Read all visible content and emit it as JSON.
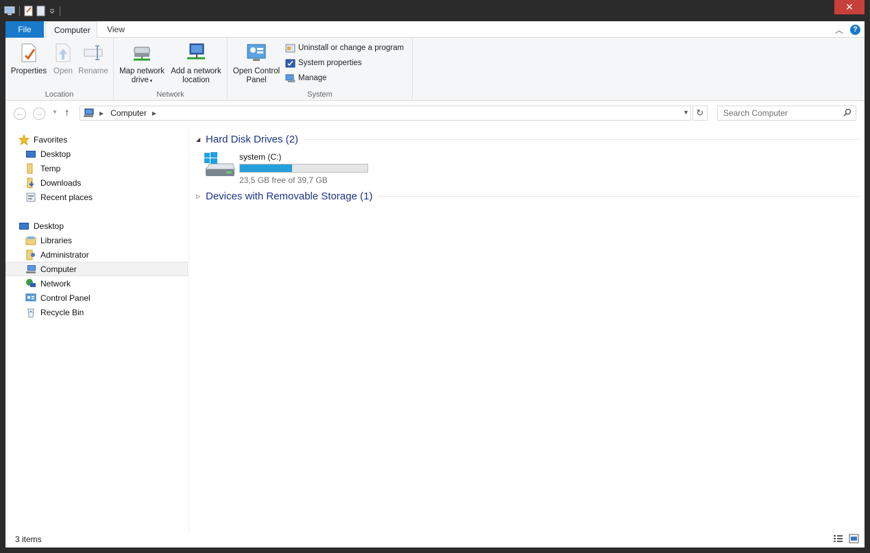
{
  "window": {
    "close_label": "✕"
  },
  "ribbon": {
    "tabs": [
      {
        "label": "File"
      },
      {
        "label": "Computer"
      },
      {
        "label": "View"
      }
    ],
    "groups": {
      "location": {
        "label": "Location",
        "properties": "Properties",
        "open": "Open",
        "rename": "Rename"
      },
      "network": {
        "label": "Network",
        "map_line1": "Map network",
        "map_line2": "drive",
        "add_line1": "Add a network",
        "add_line2": "location"
      },
      "system": {
        "label": "System",
        "open_cp_line1": "Open Control",
        "open_cp_line2": "Panel",
        "uninstall": "Uninstall or change a program",
        "system_properties": "System properties",
        "manage": "Manage"
      }
    },
    "help": "?"
  },
  "address": {
    "location": "Computer",
    "search_placeholder": "Search Computer"
  },
  "nav": {
    "favorites": "Favorites",
    "fav_items": [
      "Desktop",
      "Temp",
      "Downloads",
      "Recent places"
    ],
    "desktop": "Desktop",
    "desktop_items": [
      "Libraries",
      "Administrator",
      "Computer",
      "Network",
      "Control Panel",
      "Recycle Bin"
    ]
  },
  "content": {
    "hdd_header": "Hard Disk Drives (2)",
    "drive": {
      "name": "system (C:)",
      "free_text": "23,5 GB free of 39,7 GB",
      "used_fraction": 0.41
    },
    "removable_header": "Devices with Removable Storage (1)"
  },
  "status": {
    "items": "3 items"
  },
  "colors": {
    "accent": "#1979ca",
    "header_text": "#1e3287",
    "drive_fill": "#26a0da",
    "close_red": "#c7403a"
  }
}
